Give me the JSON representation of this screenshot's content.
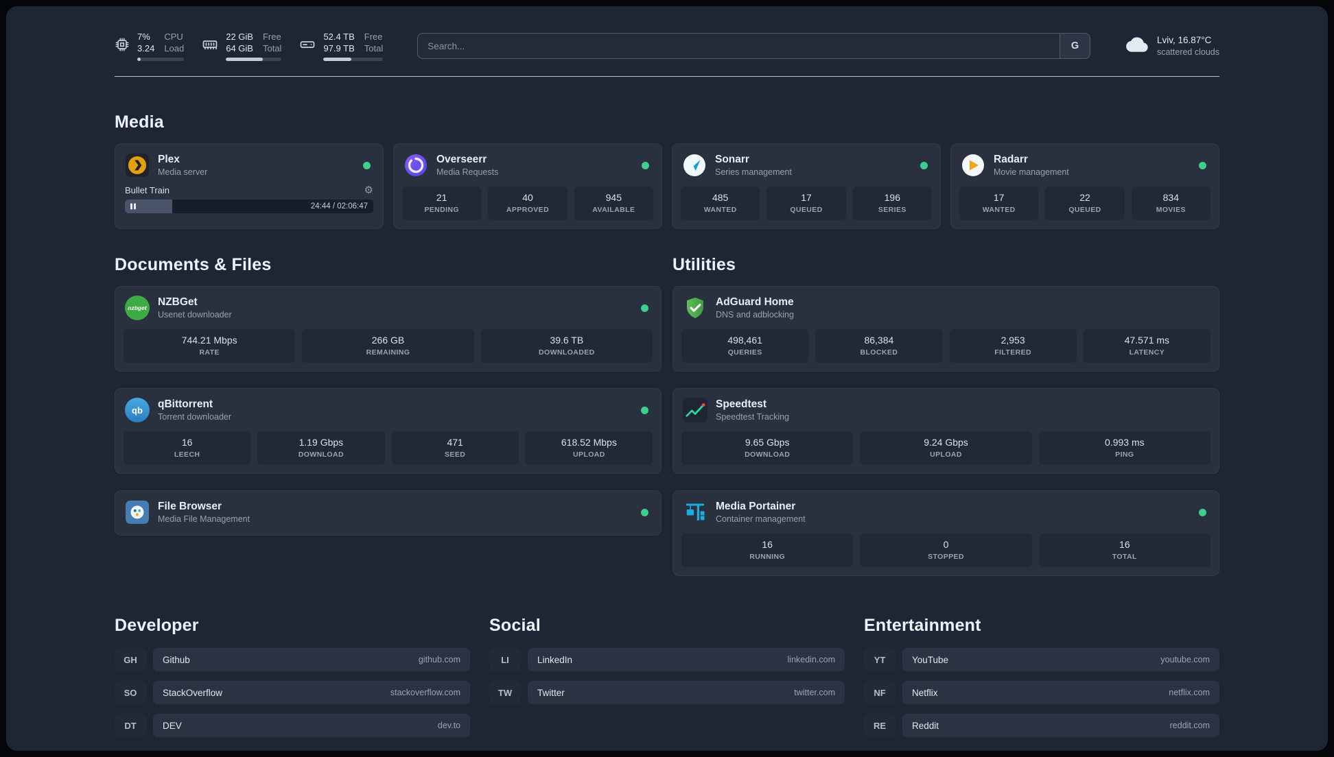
{
  "topbar": {
    "cpu": {
      "value1": "7%",
      "value2": "3.24",
      "label1": "CPU",
      "label2": "Load",
      "bar": 7
    },
    "memory": {
      "value1": "22 GiB",
      "value2": "64 GiB",
      "label1": "Free",
      "label2": "Total",
      "bar": 66
    },
    "disk": {
      "value1": "52.4 TB",
      "value2": "97.9 TB",
      "label1": "Free",
      "label2": "Total",
      "bar": 47
    },
    "search": {
      "placeholder": "Search...",
      "button": "G"
    },
    "weather": {
      "location": "Lviv, 16.87°C",
      "condition": "scattered clouds"
    }
  },
  "sections": {
    "media": {
      "title": "Media"
    },
    "documents": {
      "title": "Documents & Files"
    },
    "utilities": {
      "title": "Utilities"
    }
  },
  "services": {
    "plex": {
      "name": "Plex",
      "desc": "Media server",
      "player": {
        "title": "Bullet Train",
        "time": "24:44 / 02:06:47",
        "progress": 19
      }
    },
    "overseerr": {
      "name": "Overseerr",
      "desc": "Media Requests",
      "stats": [
        {
          "value": "21",
          "label": "PENDING"
        },
        {
          "value": "40",
          "label": "APPROVED"
        },
        {
          "value": "945",
          "label": "AVAILABLE"
        }
      ]
    },
    "sonarr": {
      "name": "Sonarr",
      "desc": "Series management",
      "stats": [
        {
          "value": "485",
          "label": "WANTED"
        },
        {
          "value": "17",
          "label": "QUEUED"
        },
        {
          "value": "196",
          "label": "SERIES"
        }
      ]
    },
    "radarr": {
      "name": "Radarr",
      "desc": "Movie management",
      "stats": [
        {
          "value": "17",
          "label": "WANTED"
        },
        {
          "value": "22",
          "label": "QUEUED"
        },
        {
          "value": "834",
          "label": "MOVIES"
        }
      ]
    },
    "nzbget": {
      "name": "NZBGet",
      "desc": "Usenet downloader",
      "icon_text": "nzbget",
      "stats": [
        {
          "value": "744.21 Mbps",
          "label": "RATE"
        },
        {
          "value": "266 GB",
          "label": "REMAINING"
        },
        {
          "value": "39.6 TB",
          "label": "DOWNLOADED"
        }
      ]
    },
    "qbittorrent": {
      "name": "qBittorrent",
      "desc": "Torrent downloader",
      "icon_text": "qb",
      "stats": [
        {
          "value": "16",
          "label": "LEECH"
        },
        {
          "value": "1.19 Gbps",
          "label": "DOWNLOAD"
        },
        {
          "value": "471",
          "label": "SEED"
        },
        {
          "value": "618.52 Mbps",
          "label": "UPLOAD"
        }
      ]
    },
    "filebrowser": {
      "name": "File Browser",
      "desc": "Media File Management"
    },
    "adguard": {
      "name": "AdGuard Home",
      "desc": "DNS and adblocking",
      "stats": [
        {
          "value": "498,461",
          "label": "QUERIES"
        },
        {
          "value": "86,384",
          "label": "BLOCKED"
        },
        {
          "value": "2,953",
          "label": "FILTERED"
        },
        {
          "value": "47.571 ms",
          "label": "LATENCY"
        }
      ]
    },
    "speedtest": {
      "name": "Speedtest",
      "desc": "Speedtest Tracking",
      "stats": [
        {
          "value": "9.65 Gbps",
          "label": "DOWNLOAD"
        },
        {
          "value": "9.24 Gbps",
          "label": "UPLOAD"
        },
        {
          "value": "0.993 ms",
          "label": "PING"
        }
      ]
    },
    "portainer": {
      "name": "Media Portainer",
      "desc": "Container management",
      "stats": [
        {
          "value": "16",
          "label": "RUNNING"
        },
        {
          "value": "0",
          "label": "STOPPED"
        },
        {
          "value": "16",
          "label": "TOTAL"
        }
      ]
    }
  },
  "bookmarks": {
    "developer": {
      "title": "Developer",
      "items": [
        {
          "abbr": "GH",
          "name": "Github",
          "domain": "github.com"
        },
        {
          "abbr": "SO",
          "name": "StackOverflow",
          "domain": "stackoverflow.com"
        },
        {
          "abbr": "DT",
          "name": "DEV",
          "domain": "dev.to"
        }
      ]
    },
    "social": {
      "title": "Social",
      "items": [
        {
          "abbr": "LI",
          "name": "LinkedIn",
          "domain": "linkedin.com"
        },
        {
          "abbr": "TW",
          "name": "Twitter",
          "domain": "twitter.com"
        }
      ]
    },
    "entertainment": {
      "title": "Entertainment",
      "items": [
        {
          "abbr": "YT",
          "name": "YouTube",
          "domain": "youtube.com"
        },
        {
          "abbr": "NF",
          "name": "Netflix",
          "domain": "netflix.com"
        },
        {
          "abbr": "RE",
          "name": "Reddit",
          "domain": "reddit.com"
        }
      ]
    }
  }
}
